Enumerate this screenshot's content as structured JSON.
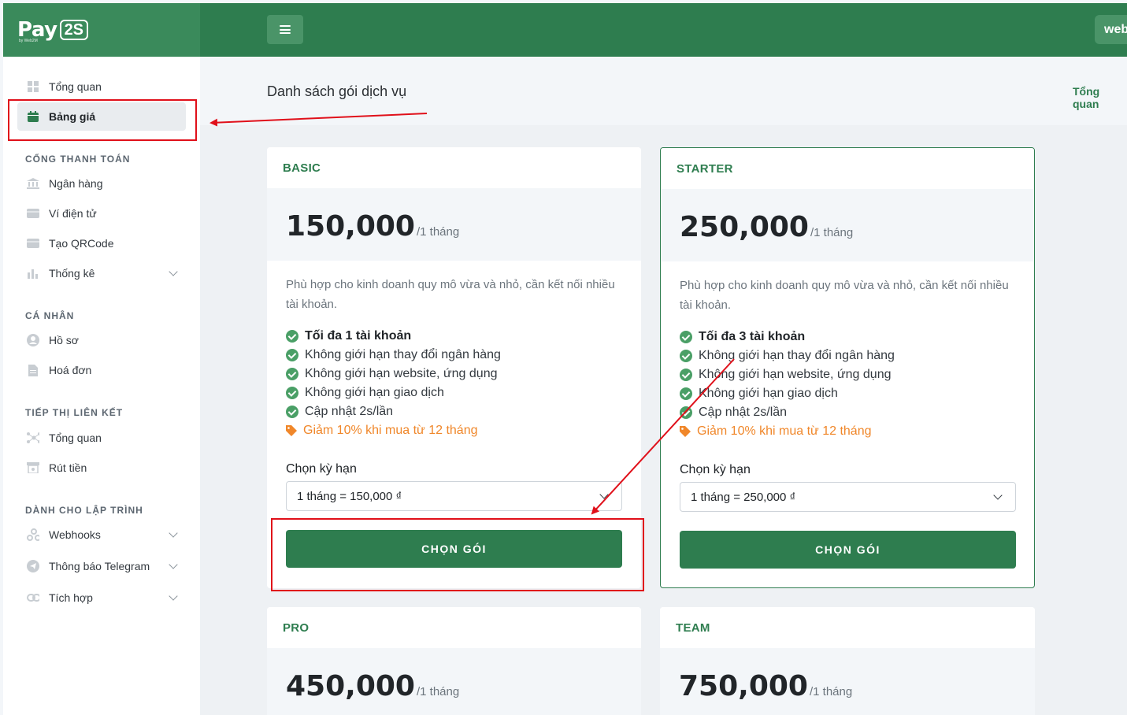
{
  "header": {
    "logo_text": "Pay",
    "logo_badge": "2S",
    "logo_sub": "by Web2M",
    "user_label": "web"
  },
  "sidebar": {
    "items_top": [
      {
        "label": "Tổng quan",
        "icon": "grid-icon"
      },
      {
        "label": "Bảng giá",
        "icon": "calendar-icon",
        "active": true
      }
    ],
    "sections": [
      {
        "title": "CỔNG THANH TOÁN",
        "items": [
          {
            "label": "Ngân hàng",
            "icon": "bank-icon"
          },
          {
            "label": "Ví điện tử",
            "icon": "wallet-icon"
          },
          {
            "label": "Tạo QRCode",
            "icon": "qrcode-icon"
          },
          {
            "label": "Thống kê",
            "icon": "chart-icon"
          }
        ]
      },
      {
        "title": "CÁ NHÂN",
        "items": [
          {
            "label": "Hồ sơ",
            "icon": "user-icon"
          },
          {
            "label": "Hoá đơn",
            "icon": "invoice-icon"
          }
        ]
      },
      {
        "title": "TIẾP THỊ LIÊN KẾT",
        "items": [
          {
            "label": "Tổng quan",
            "icon": "network-icon"
          },
          {
            "label": "Rút tiền",
            "icon": "withdraw-icon"
          }
        ]
      },
      {
        "title": "DÀNH CHO LẬP TRÌNH",
        "items": [
          {
            "label": "Webhooks",
            "icon": "webhook-icon"
          },
          {
            "label": "Thông báo Telegram",
            "icon": "telegram-icon"
          },
          {
            "label": "Tích hợp",
            "icon": "link-icon"
          }
        ]
      }
    ]
  },
  "page": {
    "title": "Danh sách gói dịch vụ",
    "breadcrumb": "Tổng quan"
  },
  "plans": [
    {
      "name": "BASIC",
      "price": "150,000",
      "per": "/1 tháng",
      "description": "Phù hợp cho kinh doanh quy mô vừa và nhỏ, cần kết nối nhiều tài khoản.",
      "features": [
        "Tối đa 1 tài khoản",
        "Không giới hạn thay đổi ngân hàng",
        "Không giới hạn website, ứng dụng",
        "Không giới hạn giao dịch",
        "Cập nhật 2s/lần"
      ],
      "promo": "Giảm 10% khi mua từ 12 tháng",
      "term_label": "Chọn kỳ hạn",
      "term_value": "1 tháng = 150,000 ₫",
      "button": "CHỌN GÓI"
    },
    {
      "name": "STARTER",
      "price": "250,000",
      "per": "/1 tháng",
      "description": "Phù hợp cho kinh doanh quy mô vừa và nhỏ, cần kết nối nhiều tài khoản.",
      "features": [
        "Tối đa 3 tài khoản",
        "Không giới hạn thay đổi ngân hàng",
        "Không giới hạn website, ứng dụng",
        "Không giới hạn giao dịch",
        "Cập nhật 2s/lần"
      ],
      "promo": "Giảm 10% khi mua từ 12 tháng",
      "term_label": "Chọn kỳ hạn",
      "term_value": "1 tháng = 250,000 ₫",
      "button": "CHỌN GÓI"
    },
    {
      "name": "PRO",
      "price": "450,000",
      "per": "/1 tháng"
    },
    {
      "name": "TEAM",
      "price": "750,000",
      "per": "/1 tháng"
    }
  ],
  "colors": {
    "primary": "#2e7d4f",
    "promo": "#f0872a",
    "annotation": "#e0101a"
  }
}
